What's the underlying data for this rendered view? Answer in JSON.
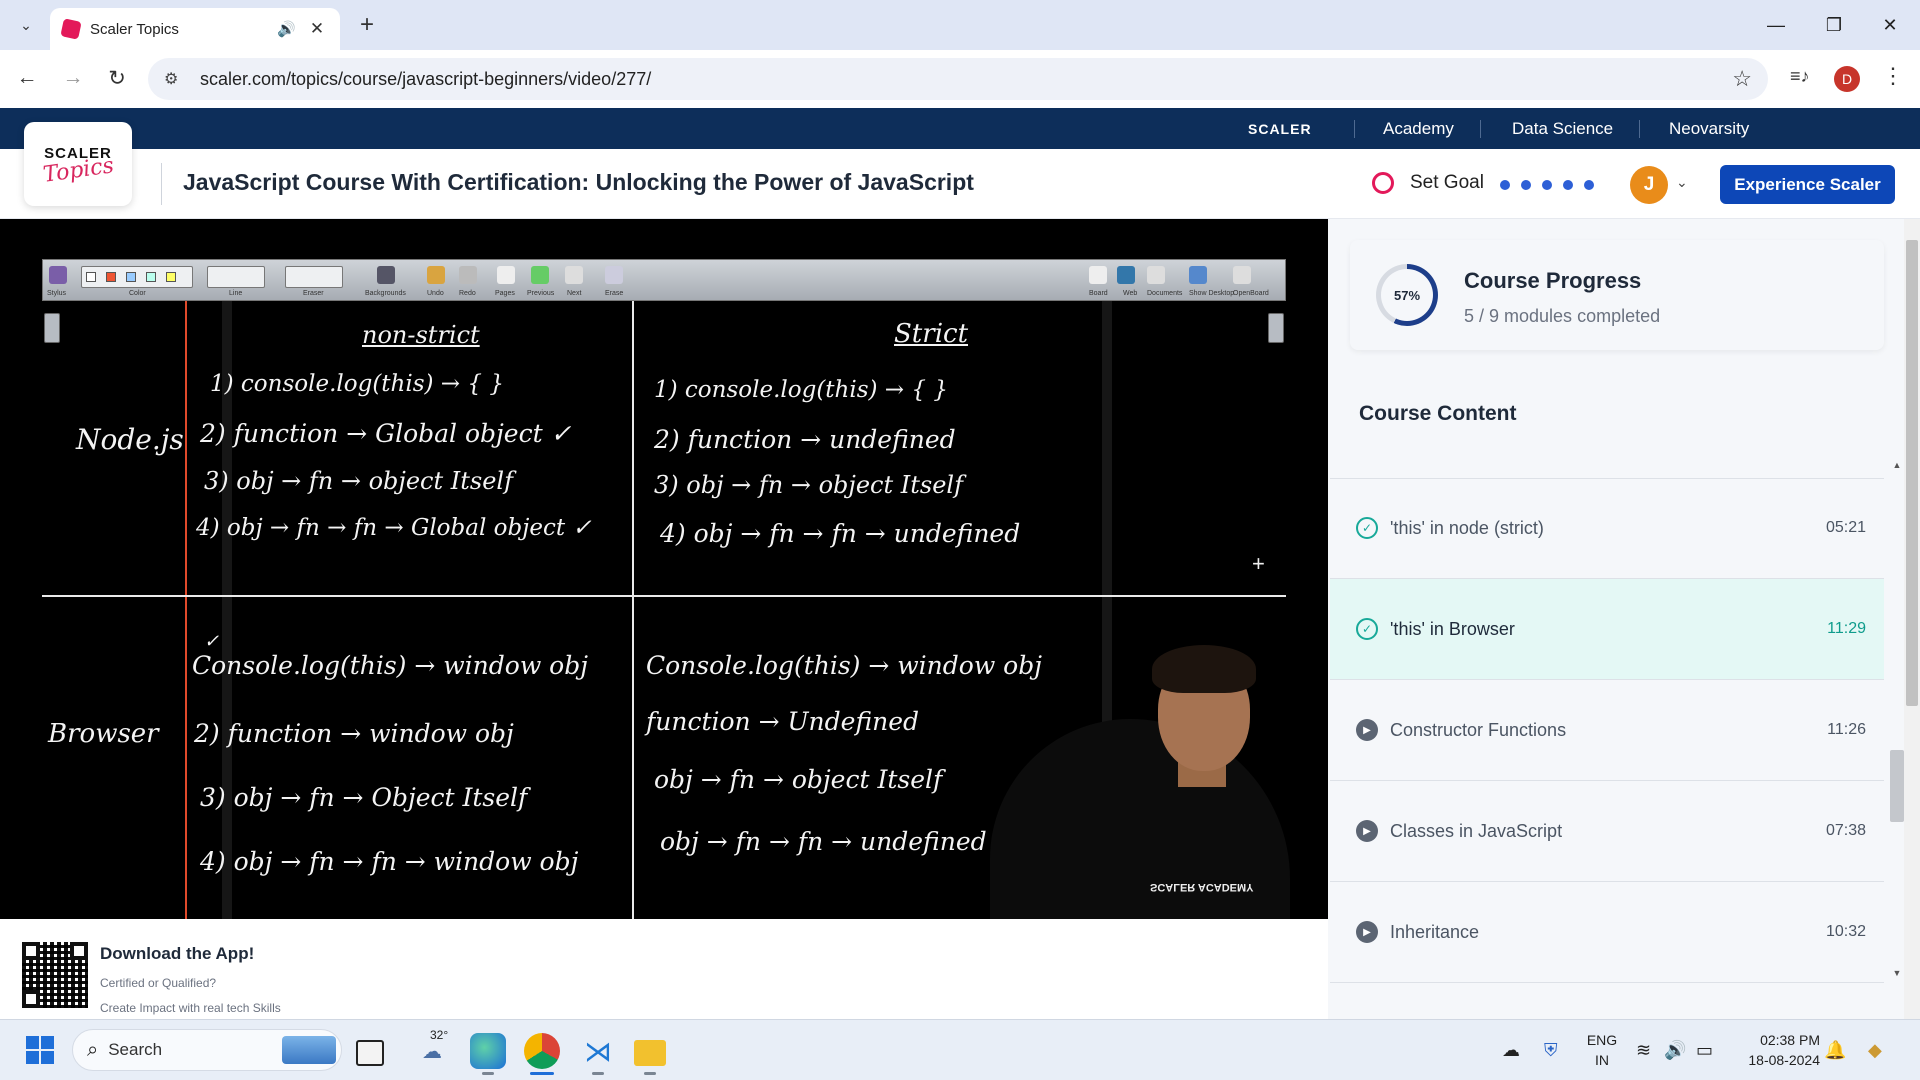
{
  "browser": {
    "tab_title": "Scaler Topics",
    "url": "scaler.com/topics/course/javascript-beginners/video/277/",
    "profile_initial": "D",
    "icons": [
      "tab-search-icon",
      "favicon",
      "audio-icon",
      "close-icon",
      "plus-icon",
      "minimize-icon",
      "restore-icon",
      "window-close-icon",
      "back-icon",
      "forward-icon",
      "reload-icon",
      "site-info-icon",
      "star-icon",
      "media-control-icon",
      "more-icon"
    ]
  },
  "topbar": {
    "brand": "SCALER",
    "links": [
      "Academy",
      "Data Science",
      "Neovarsity"
    ]
  },
  "header": {
    "logo_line1": "SCALER",
    "logo_line2": "Topics",
    "course_title": "JavaScript Course With Certification: Unlocking the Power of JavaScript",
    "set_goal": "Set Goal",
    "goal_dots": 5,
    "user_initial": "J",
    "cta": "Experience Scaler"
  },
  "video": {
    "board": {
      "toolbar_labels": [
        "Stylus",
        "Color",
        "Line",
        "Eraser",
        "Backgrounds",
        "Undo",
        "Redo",
        "Pages",
        "Previous",
        "Next",
        "Erase",
        "Board",
        "Web",
        "Documents",
        "Show Desktop",
        "OpenBoard"
      ],
      "headings": {
        "non_strict": "non-strict",
        "strict": "Strict"
      },
      "rows": {
        "node": "Node.js",
        "browser": "Browser"
      },
      "node_nonstrict": [
        "1) console.log(this) → { }",
        "2) function → Global object ✓",
        "3) obj → fn → object Itself",
        "4) obj → fn → fn → Global object ✓"
      ],
      "node_strict": [
        "1) console.log(this) → { }",
        "2) function → undefined",
        "3) obj → fn → object Itself",
        "4) obj → fn → fn → undefined"
      ],
      "browser_nonstrict": [
        "✓",
        "Console.log(this) → window obj",
        "2) function → window obj",
        "3) obj → fn → Object Itself",
        "4) obj → fn → fn → window obj"
      ],
      "browser_strict": [
        "Console.log(this) → window obj",
        "function → Undefined",
        "obj → fn → object Itself",
        "obj → fn → fn → undefined"
      ]
    },
    "shirt_text": "SCALER ACADEMY"
  },
  "progress": {
    "percent_label": "57%",
    "percent_value": 0.57,
    "title": "Course Progress",
    "subtitle": "5 / 9 modules completed"
  },
  "content": {
    "title": "Course Content",
    "lessons": [
      {
        "title": "'this' in node (strict)",
        "time": "05:21",
        "status": "done"
      },
      {
        "title": "'this' in Browser",
        "time": "11:29",
        "status": "done-active"
      },
      {
        "title": "Constructor Functions",
        "time": "11:26",
        "status": "play"
      },
      {
        "title": "Classes in JavaScript",
        "time": "07:38",
        "status": "play"
      },
      {
        "title": "Inheritance",
        "time": "10:32",
        "status": "play"
      }
    ]
  },
  "download": {
    "title": "Download the App!",
    "sub1": "Certified or Qualified?",
    "sub2": "Create Impact with real tech Skills"
  },
  "taskbar": {
    "search_placeholder": "Search",
    "weather_temp": "32°",
    "lang_line1": "ENG",
    "lang_line2": "IN",
    "time": "02:38 PM",
    "date": "18-08-2024",
    "apps": [
      "file-explorer-icon",
      "edge-icon",
      "chrome-icon",
      "vscode-icon",
      "folder-icon"
    ]
  },
  "colors": {
    "topbar": "#0d2e5a",
    "cta": "#0d47b7",
    "accent_pink": "#e3195a",
    "done_teal": "#18a999",
    "active_row": "#e4f8f5"
  }
}
